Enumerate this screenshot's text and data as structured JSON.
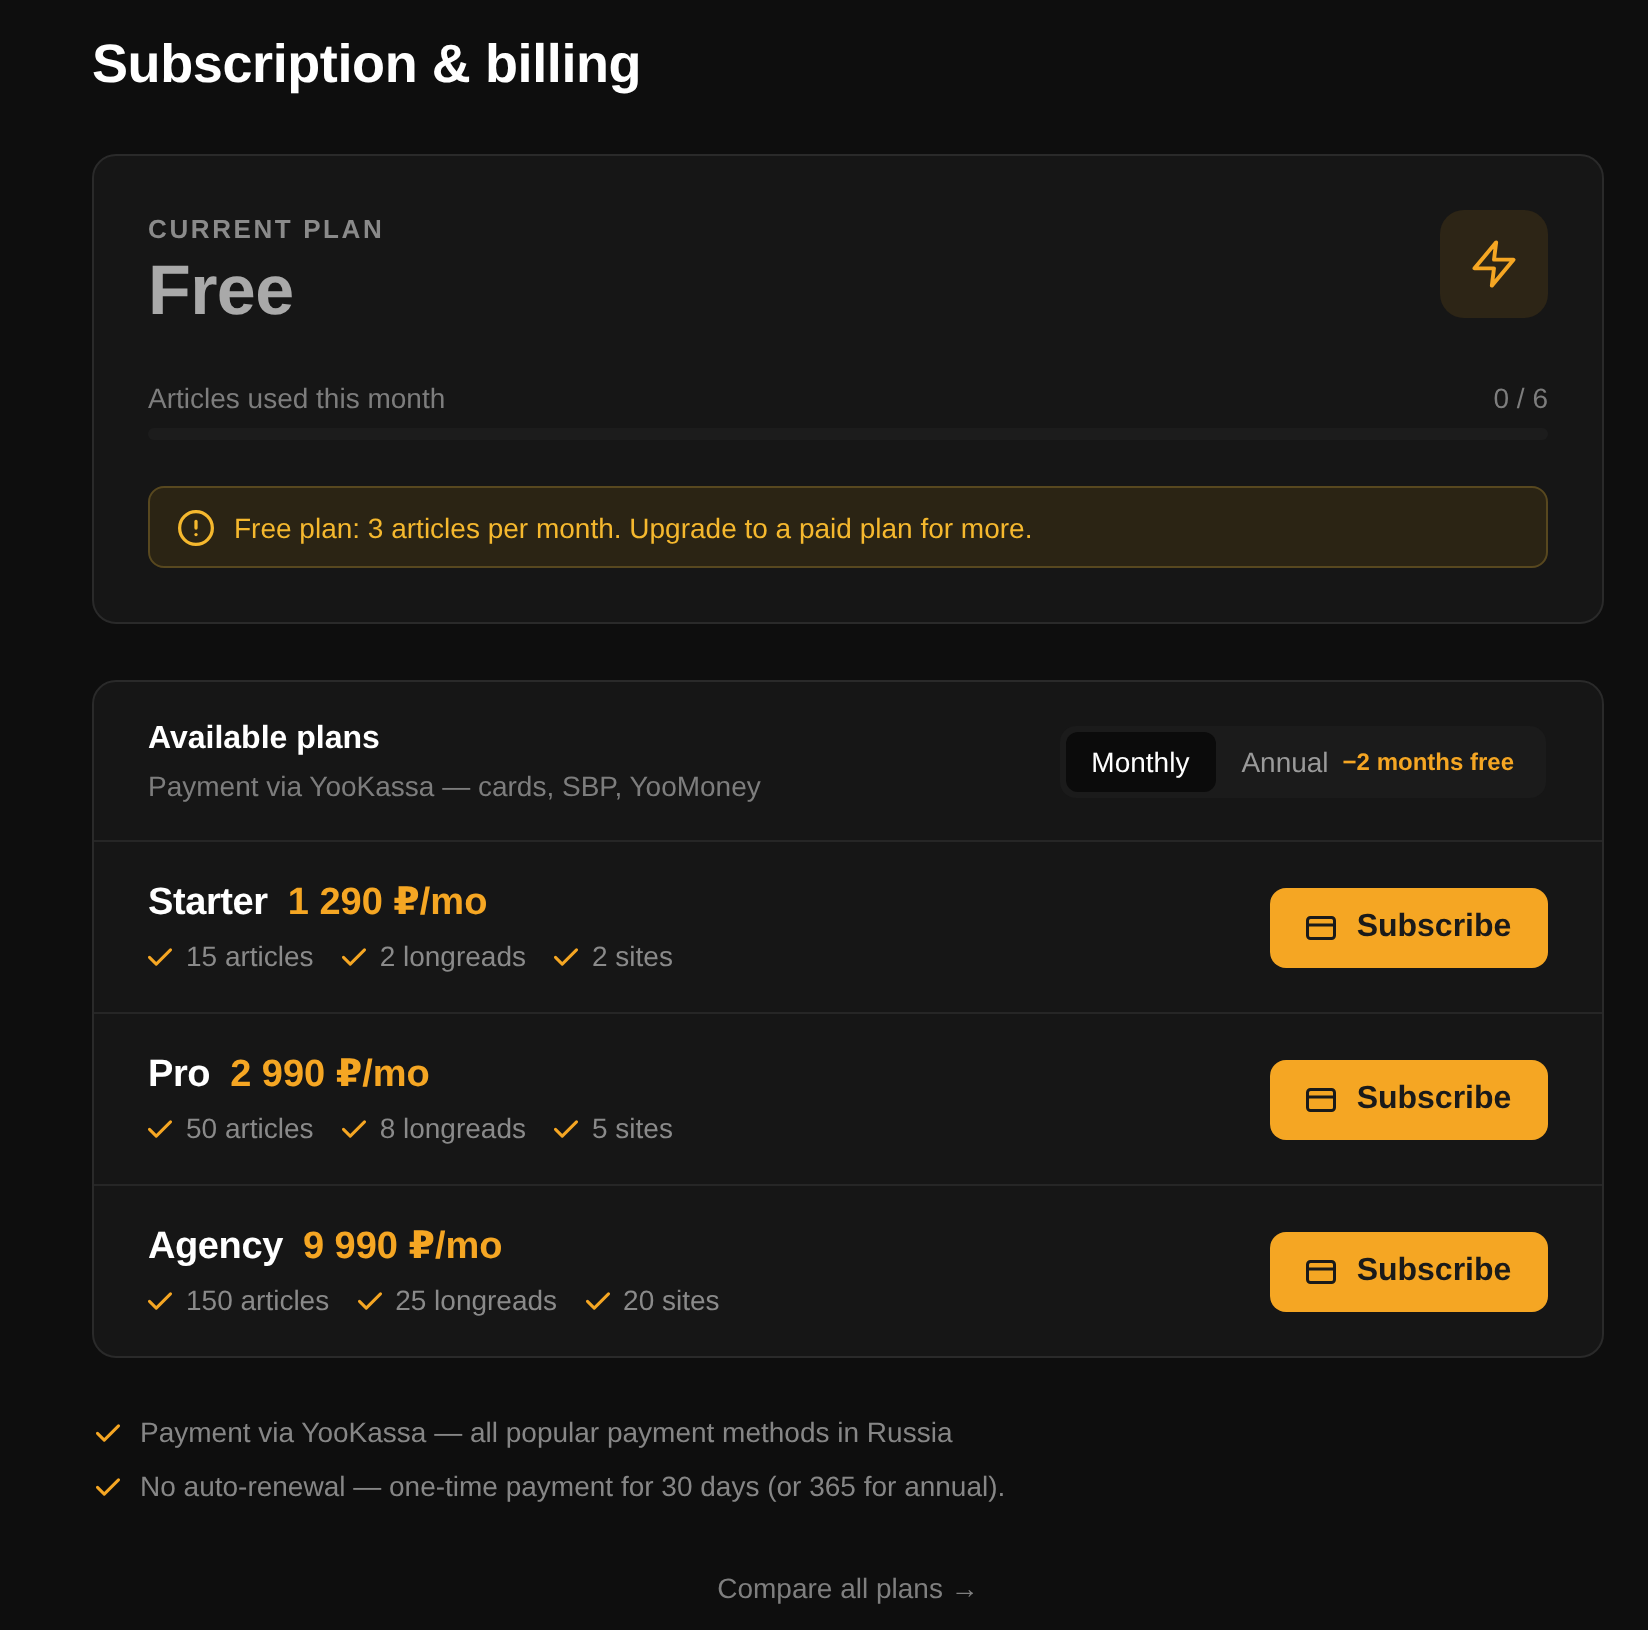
{
  "page": {
    "title": "Subscription & billing"
  },
  "current_plan": {
    "label": "CURRENT PLAN",
    "name": "Free",
    "usage": {
      "label": "Articles used this month",
      "count": "0 / 6",
      "level": 0
    },
    "alert": {
      "text": "Free plan: 3 articles per month. Upgrade to a paid plan for more."
    }
  },
  "plans_panel": {
    "title": "Available plans",
    "subtitle": "Payment via YooKassa — cards, SBP, YooMoney",
    "billing_toggle": [
      {
        "label": "Monthly",
        "selected": true
      },
      {
        "label": "Annual",
        "selected": false,
        "badge": "−2 months free"
      }
    ],
    "plans": [
      {
        "name": "Starter",
        "price": "1 290 ₽/mo",
        "features": [
          "15 articles",
          "2 longreads",
          "2 sites"
        ],
        "button": "Subscribe"
      },
      {
        "name": "Pro",
        "price": "2 990 ₽/mo",
        "features": [
          "50 articles",
          "8 longreads",
          "5 sites"
        ],
        "button": "Subscribe"
      },
      {
        "name": "Agency",
        "price": "9 990 ₽/mo",
        "features": [
          "150 articles",
          "25 longreads",
          "20 sites"
        ],
        "button": "Subscribe"
      }
    ]
  },
  "notes": [
    "Payment via YooKassa — all popular payment methods in Russia",
    "No auto-renewal — one-time payment for 30 days (or 365 for annual)."
  ],
  "compare_link": "Compare all plans →"
}
